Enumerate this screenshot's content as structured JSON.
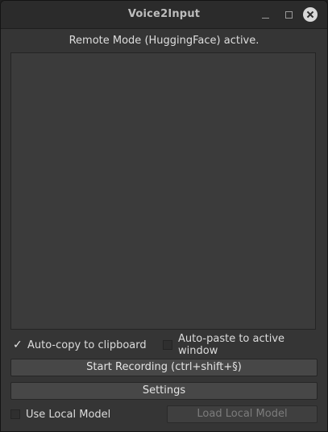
{
  "window": {
    "title": "Voice2Input"
  },
  "status": {
    "text": "Remote Mode (HuggingFace) active."
  },
  "transcript": {
    "value": ""
  },
  "options": {
    "auto_copy": {
      "label": "Auto-copy to clipboard",
      "checked": true
    },
    "auto_paste": {
      "label": "Auto-paste to active window",
      "checked": false
    },
    "use_local_model": {
      "label": "Use Local Model",
      "checked": false
    }
  },
  "buttons": {
    "start_recording": "Start Recording (ctrl+shift+§)",
    "settings": "Settings",
    "load_local_model": "Load Local Model"
  },
  "icons": {
    "minimize": "minimize-icon",
    "maximize": "maximize-icon",
    "close": "close-icon",
    "check": "✓"
  }
}
